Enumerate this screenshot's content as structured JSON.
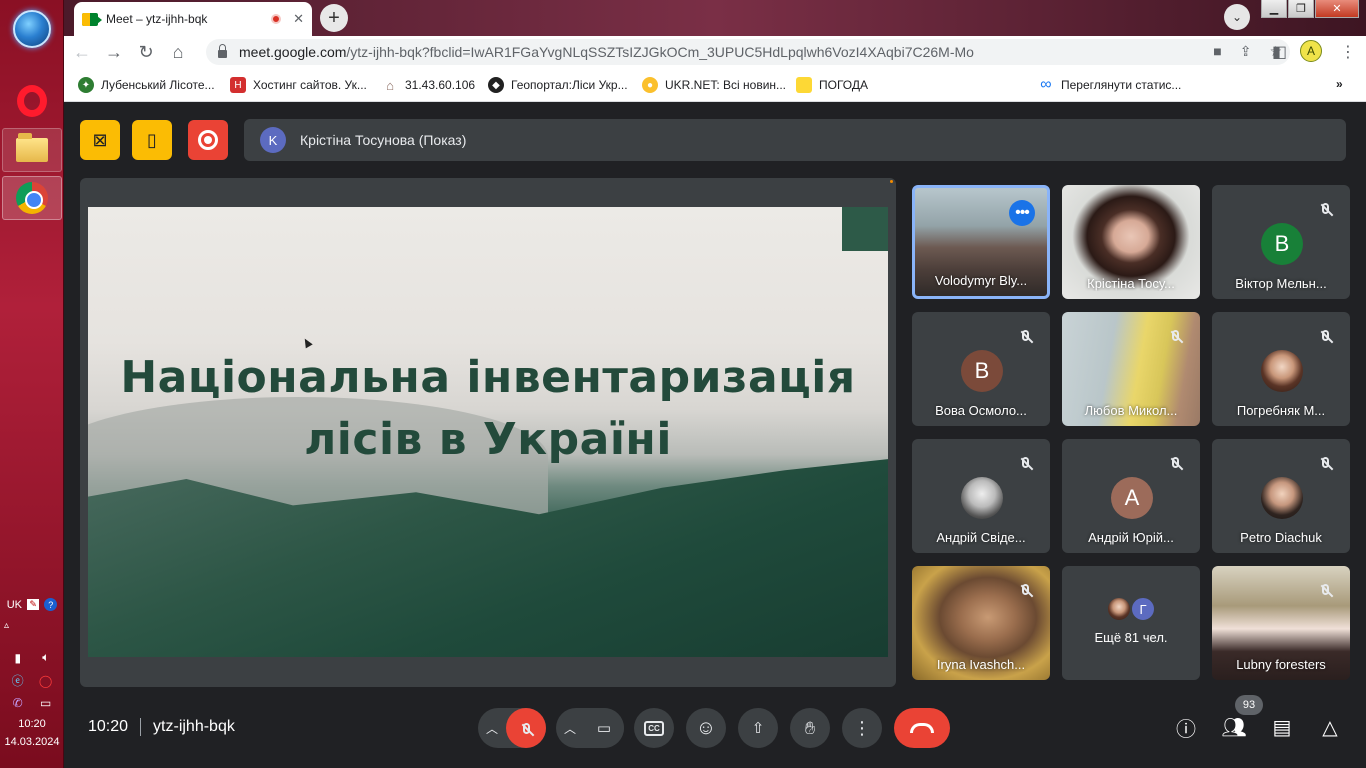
{
  "os": {
    "language": "UK",
    "clock_time": "10:20",
    "clock_date": "14.03.2024"
  },
  "browser": {
    "tab_title": "Meet – ytz-ijhh-bqk",
    "tab_close": "✕",
    "new_tab": "+",
    "url_host": "meet.google.com",
    "url_rest": "/ytz-ijhh-bqk?fbclid=IwAR1FGaYvgNLqSSZTsIZJGkOCm_3UPUC5HdLpqlwh6VozI4XAqbi7C26M-Mo",
    "bookmarks": [
      {
        "label": "Лубенський Лісоте...",
        "icon_color": "#2e7d32"
      },
      {
        "label": "Хостинг сайтов. Ук...",
        "icon_color": "#d32f2f"
      },
      {
        "label": "31.43.60.106",
        "icon_color": "#8d6e63"
      },
      {
        "label": "Геопортал:Ліси Укр...",
        "icon_color": "#212121"
      },
      {
        "label": "UKR.NET: Всі новин...",
        "icon_color": "#fbc02d"
      },
      {
        "label": "ПОГОДА",
        "icon_color": "#fdd835"
      },
      {
        "label": "Переглянути статис...",
        "icon_color": "#1877f2"
      }
    ],
    "bookmarks_more": "»"
  },
  "meet": {
    "presenter_initial": "K",
    "presenter_text": "Крістіна Тосунова (Показ)",
    "slide_title_line1": "Національна інвентаризація",
    "slide_title_line2": "лісів в Україні",
    "participants": [
      {
        "name": "Volodymyr Bly...",
        "type": "video-class",
        "muted": false,
        "active": true
      },
      {
        "name": "Крістіна Тосу...",
        "type": "video-woman",
        "muted": false
      },
      {
        "name": "Віктор Мельн...",
        "type": "initial",
        "initial": "В",
        "color": "#188038",
        "muted": true
      },
      {
        "name": "Вова Осмоло...",
        "type": "initial",
        "initial": "В",
        "color": "#7b4a3a",
        "muted": true
      },
      {
        "name": "Любов Микол...",
        "type": "video-lyubov",
        "muted": true
      },
      {
        "name": "Погребняк М...",
        "type": "photo",
        "muted": true
      },
      {
        "name": "Андрій Свіде...",
        "type": "photo",
        "muted": true
      },
      {
        "name": "Андрій Юрій...",
        "type": "initial",
        "initial": "А",
        "color": "#9c6b5a",
        "muted": true
      },
      {
        "name": "Petro Diachuk",
        "type": "photo",
        "muted": true
      },
      {
        "name": "Iryna Ivashch...",
        "type": "video-iryna",
        "muted": true
      },
      {
        "name": "Ещё 81 чел.",
        "type": "more",
        "initial": "Г"
      },
      {
        "name": "Lubny foresters",
        "type": "video-lubny",
        "muted": true
      }
    ],
    "meeting_time": "10:20",
    "meeting_code": "ytz-ijhh-bqk",
    "participant_count": "93",
    "colors": {
      "hangup": "#ea4335",
      "accent_yellow": "#fbbc04",
      "tile_bg": "#3c4043",
      "background": "#202124"
    }
  }
}
